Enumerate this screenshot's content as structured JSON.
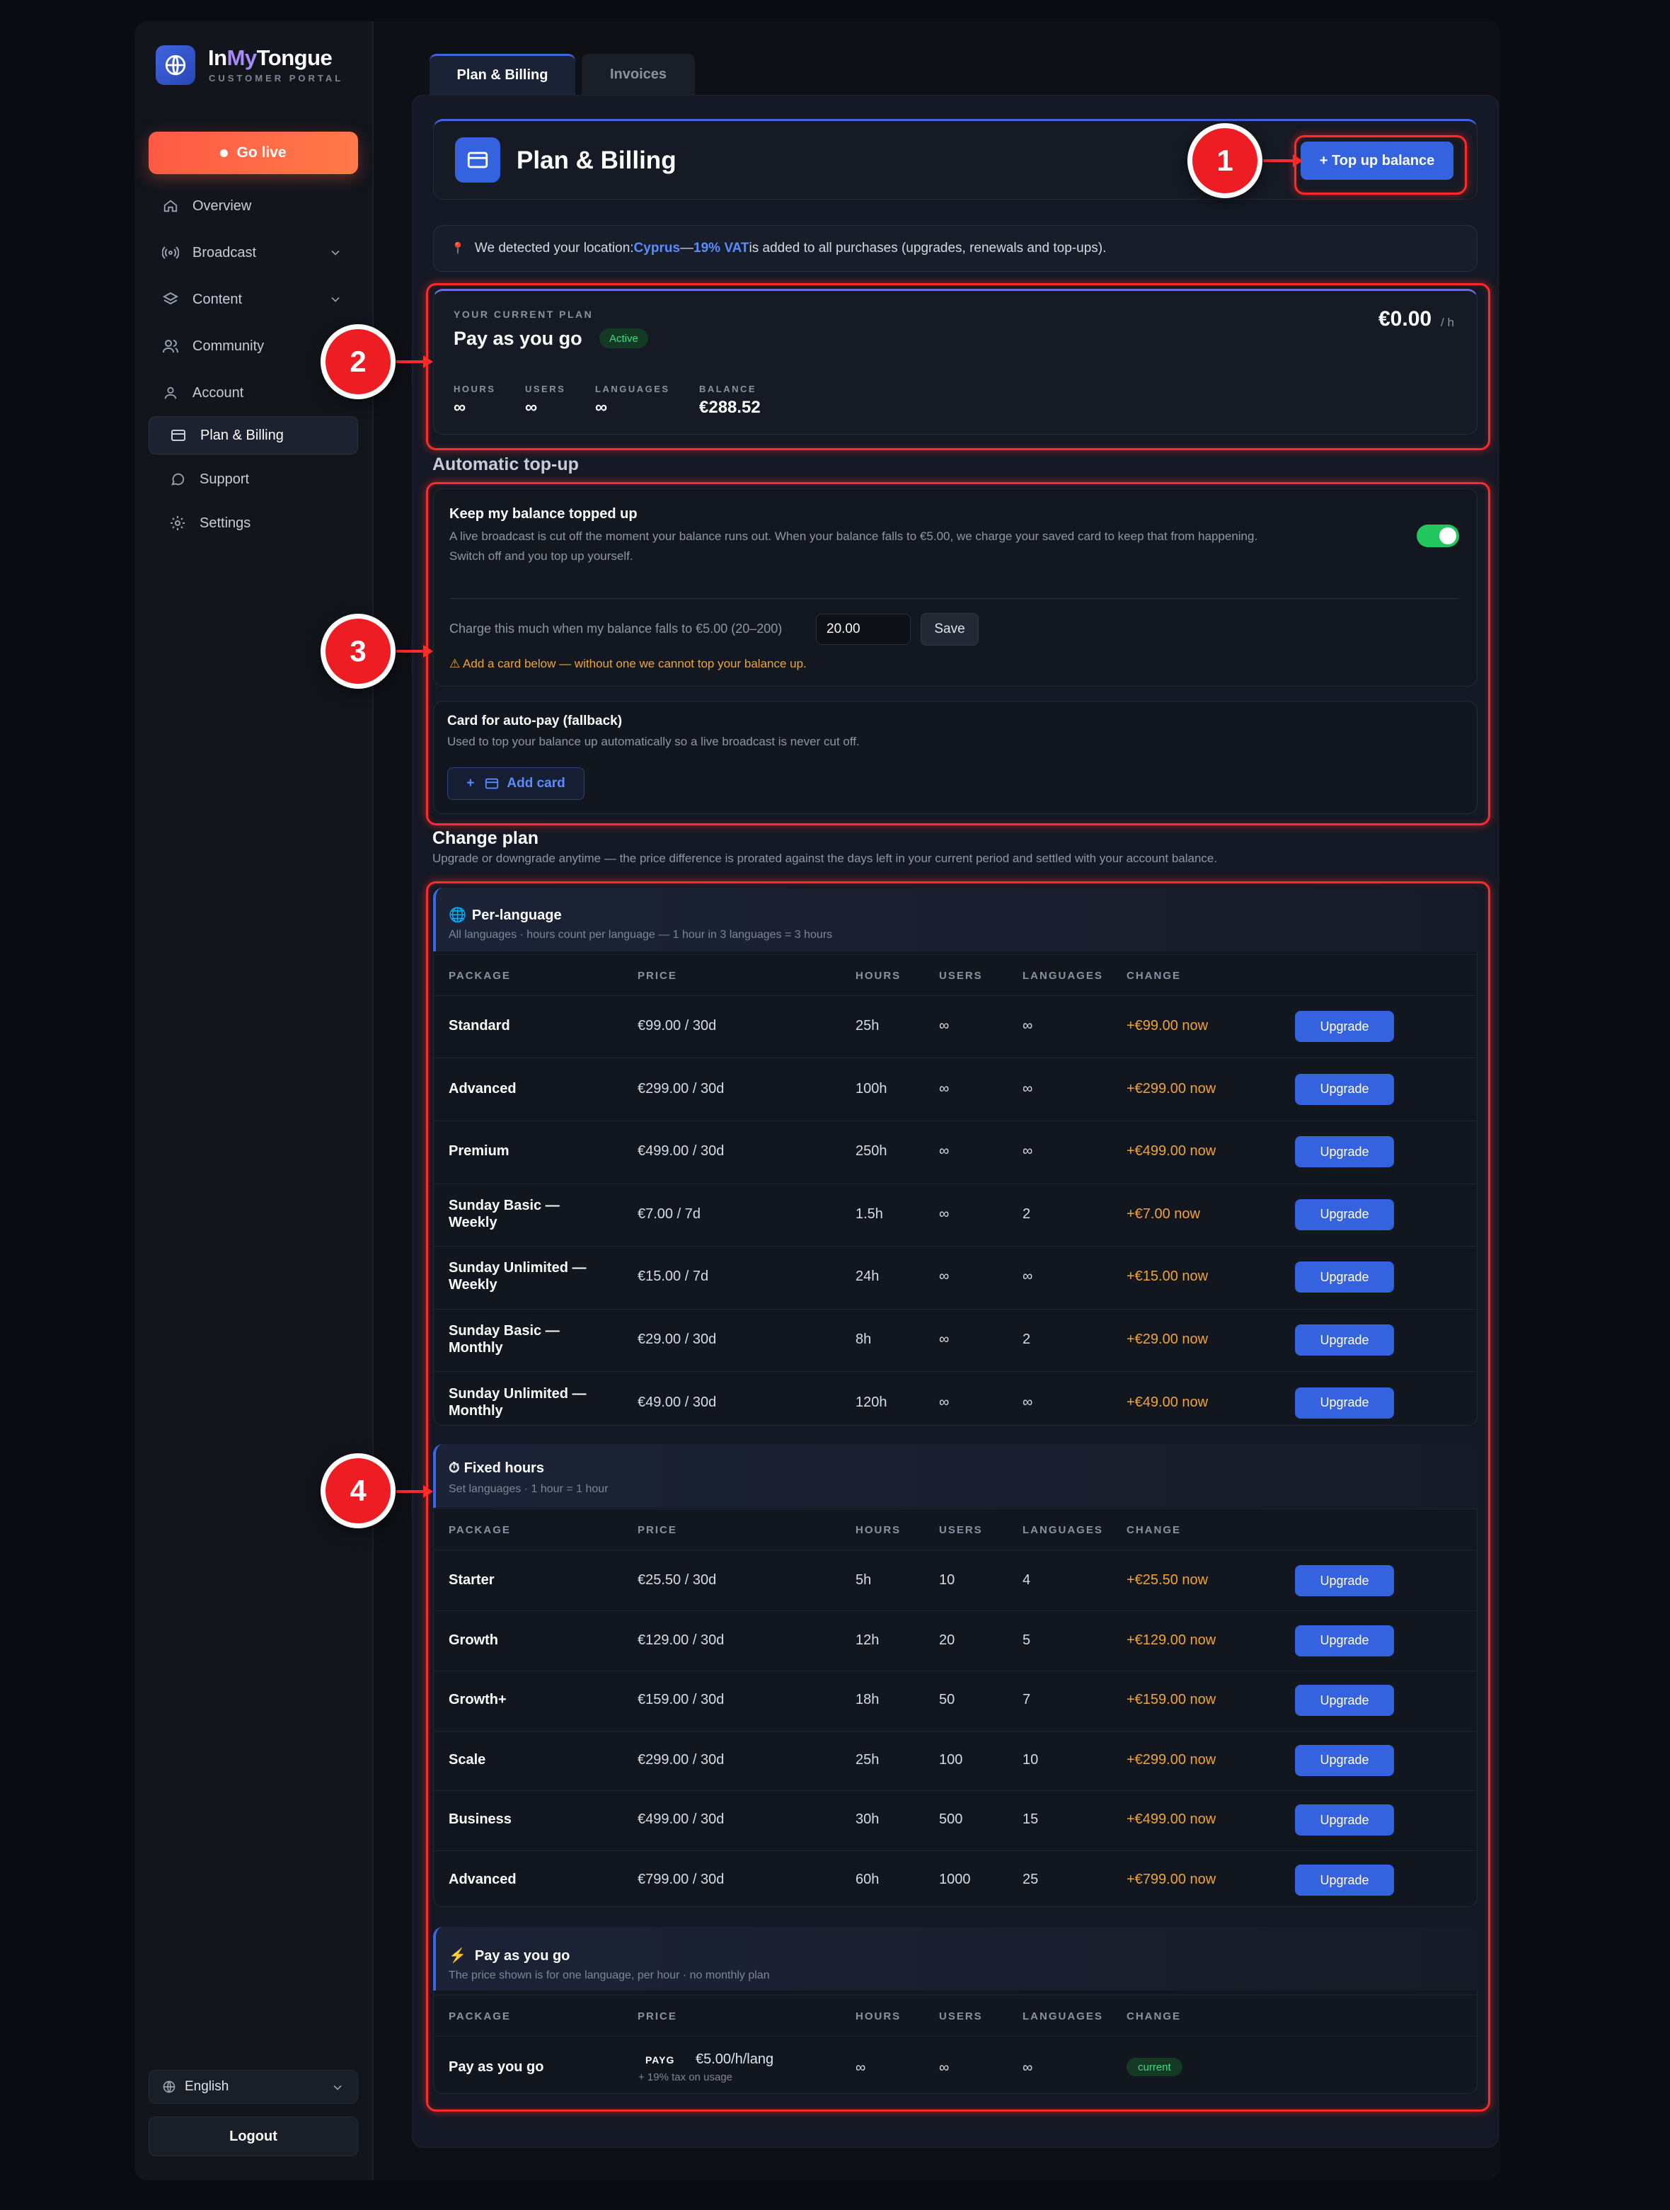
{
  "app": {
    "name_prefix": "In",
    "name_mid": "My",
    "name_suffix": "Tongue",
    "subtitle": "CUSTOMER PORTAL"
  },
  "sidebar": {
    "go_live": "Go live",
    "items": [
      {
        "label": "Overview",
        "icon": "home-icon"
      },
      {
        "label": "Broadcast",
        "icon": "broadcast-icon"
      },
      {
        "label": "Content",
        "icon": "layers-icon"
      },
      {
        "label": "Community",
        "icon": "users-icon"
      },
      {
        "label": "Account",
        "icon": "user-icon"
      },
      {
        "label": "Plan & Billing",
        "icon": "card-icon"
      },
      {
        "label": "Support",
        "icon": "chat-icon"
      },
      {
        "label": "Settings",
        "icon": "gear-icon"
      }
    ],
    "language": "English",
    "logout": "Logout"
  },
  "tabs": [
    "Plan & Billing",
    "Invoices"
  ],
  "header": {
    "title": "Plan & Billing",
    "top_up": "+ Top up balance"
  },
  "location": {
    "prefix": "We detected your location: ",
    "country": "Cyprus",
    "sep": " — ",
    "vat": "19% VAT",
    "suffix": " is added to all purchases (upgrades, renewals and top-ups)."
  },
  "current_plan": {
    "label": "YOUR CURRENT PLAN",
    "name": "Pay as you go",
    "status": "Active",
    "price": "€0.00",
    "unit": "/ h",
    "stats": [
      {
        "label": "HOURS",
        "value": "∞"
      },
      {
        "label": "USERS",
        "value": "∞"
      },
      {
        "label": "LANGUAGES",
        "value": "∞"
      },
      {
        "label": "BALANCE",
        "value": "€288.52"
      }
    ]
  },
  "auto_topup": {
    "section_title": "Automatic top-up",
    "title": "Keep my balance topped up",
    "desc1": "A live broadcast is cut off the moment your balance runs out. When your balance falls to €5.00, we charge your saved card to keep that from happening.",
    "desc2": "Switch off and you top up yourself.",
    "toggle_on": true,
    "charge_label": "Charge this much when my balance falls to €5.00 (20–200)",
    "charge_value": "20.00",
    "save": "Save",
    "warning": "Add a card below — without one we cannot top your balance up."
  },
  "card": {
    "title": "Card for auto-pay (fallback)",
    "desc": "Used to top your balance up automatically so a live broadcast is never cut off.",
    "add": "Add card"
  },
  "change_plan": {
    "title": "Change plan",
    "desc": "Upgrade or downgrade anytime — the price difference is prorated against the days left in your current period and settled with your account balance.",
    "columns": [
      "PACKAGE",
      "PRICE",
      "HOURS",
      "USERS",
      "LANGUAGES",
      "CHANGE"
    ],
    "upgrade_label": "Upgrade",
    "per_language": {
      "title": "Per-language",
      "desc": "All languages · hours count per language — 1 hour in 3 languages = 3 hours",
      "rows": [
        {
          "name": "Standard",
          "name2": "",
          "price": "€99.00 / 30d",
          "hours": "25h",
          "users": "∞",
          "langs": "∞",
          "change": "+€99.00 now"
        },
        {
          "name": "Advanced",
          "name2": "",
          "price": "€299.00 / 30d",
          "hours": "100h",
          "users": "∞",
          "langs": "∞",
          "change": "+€299.00 now"
        },
        {
          "name": "Premium",
          "name2": "",
          "price": "€499.00 / 30d",
          "hours": "250h",
          "users": "∞",
          "langs": "∞",
          "change": "+€499.00 now"
        },
        {
          "name": "Sunday Basic —",
          "name2": "Weekly",
          "price": "€7.00 / 7d",
          "hours": "1.5h",
          "users": "∞",
          "langs": "2",
          "change": "+€7.00 now"
        },
        {
          "name": "Sunday Unlimited —",
          "name2": "Weekly",
          "price": "€15.00 / 7d",
          "hours": "24h",
          "users": "∞",
          "langs": "∞",
          "change": "+€15.00 now"
        },
        {
          "name": "Sunday Basic —",
          "name2": "Monthly",
          "price": "€29.00 / 30d",
          "hours": "8h",
          "users": "∞",
          "langs": "2",
          "change": "+€29.00 now"
        },
        {
          "name": "Sunday Unlimited —",
          "name2": "Monthly",
          "price": "€49.00 / 30d",
          "hours": "120h",
          "users": "∞",
          "langs": "∞",
          "change": "+€49.00 now"
        }
      ]
    },
    "fixed_hours": {
      "title": "Fixed hours",
      "desc": "Set languages · 1 hour = 1 hour",
      "rows": [
        {
          "name": "Starter",
          "price": "€25.50 / 30d",
          "hours": "5h",
          "users": "10",
          "langs": "4",
          "change": "+€25.50 now"
        },
        {
          "name": "Growth",
          "price": "€129.00 / 30d",
          "hours": "12h",
          "users": "20",
          "langs": "5",
          "change": "+€129.00 now"
        },
        {
          "name": "Growth+",
          "price": "€159.00 / 30d",
          "hours": "18h",
          "users": "50",
          "langs": "7",
          "change": "+€159.00 now"
        },
        {
          "name": "Scale",
          "price": "€299.00 / 30d",
          "hours": "25h",
          "users": "100",
          "langs": "10",
          "change": "+€299.00 now"
        },
        {
          "name": "Business",
          "price": "€499.00 / 30d",
          "hours": "30h",
          "users": "500",
          "langs": "15",
          "change": "+€499.00 now"
        },
        {
          "name": "Advanced",
          "price": "€799.00 / 30d",
          "hours": "60h",
          "users": "1000",
          "langs": "25",
          "change": "+€799.00 now"
        }
      ]
    },
    "payg": {
      "title": "Pay as you go",
      "desc": "The price shown is for one language, per hour · no monthly plan",
      "row": {
        "name": "Pay as you go",
        "tag": "PAYG",
        "price": "€5.00/h/lang",
        "tax": "+ 19% tax on usage",
        "hours": "∞",
        "users": "∞",
        "langs": "∞",
        "change": "current"
      }
    }
  },
  "annotations": [
    "1",
    "2",
    "3",
    "4"
  ],
  "colors": {
    "accent": "#3563e0",
    "golive": "#ff5a45",
    "change": "#f0a33a",
    "active_green": "#22c55e",
    "highlight": "#ff2a2a"
  }
}
